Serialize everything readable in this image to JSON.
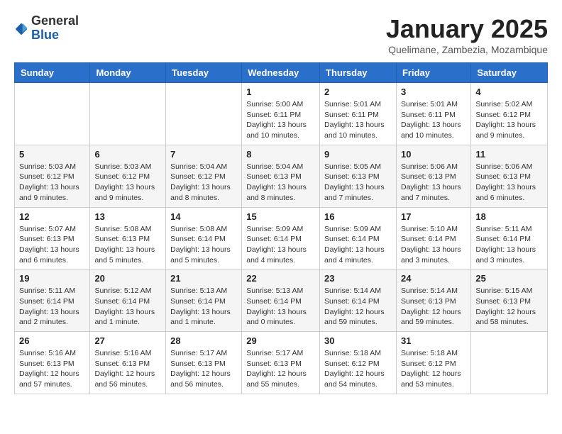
{
  "header": {
    "logo_general": "General",
    "logo_blue": "Blue",
    "month_title": "January 2025",
    "location": "Quelimane, Zambezia, Mozambique"
  },
  "weekdays": [
    "Sunday",
    "Monday",
    "Tuesday",
    "Wednesday",
    "Thursday",
    "Friday",
    "Saturday"
  ],
  "weeks": [
    [
      {
        "day": "",
        "info": ""
      },
      {
        "day": "",
        "info": ""
      },
      {
        "day": "",
        "info": ""
      },
      {
        "day": "1",
        "info": "Sunrise: 5:00 AM\nSunset: 6:11 PM\nDaylight: 13 hours and 10 minutes."
      },
      {
        "day": "2",
        "info": "Sunrise: 5:01 AM\nSunset: 6:11 PM\nDaylight: 13 hours and 10 minutes."
      },
      {
        "day": "3",
        "info": "Sunrise: 5:01 AM\nSunset: 6:11 PM\nDaylight: 13 hours and 10 minutes."
      },
      {
        "day": "4",
        "info": "Sunrise: 5:02 AM\nSunset: 6:12 PM\nDaylight: 13 hours and 9 minutes."
      }
    ],
    [
      {
        "day": "5",
        "info": "Sunrise: 5:03 AM\nSunset: 6:12 PM\nDaylight: 13 hours and 9 minutes."
      },
      {
        "day": "6",
        "info": "Sunrise: 5:03 AM\nSunset: 6:12 PM\nDaylight: 13 hours and 9 minutes."
      },
      {
        "day": "7",
        "info": "Sunrise: 5:04 AM\nSunset: 6:12 PM\nDaylight: 13 hours and 8 minutes."
      },
      {
        "day": "8",
        "info": "Sunrise: 5:04 AM\nSunset: 6:13 PM\nDaylight: 13 hours and 8 minutes."
      },
      {
        "day": "9",
        "info": "Sunrise: 5:05 AM\nSunset: 6:13 PM\nDaylight: 13 hours and 7 minutes."
      },
      {
        "day": "10",
        "info": "Sunrise: 5:06 AM\nSunset: 6:13 PM\nDaylight: 13 hours and 7 minutes."
      },
      {
        "day": "11",
        "info": "Sunrise: 5:06 AM\nSunset: 6:13 PM\nDaylight: 13 hours and 6 minutes."
      }
    ],
    [
      {
        "day": "12",
        "info": "Sunrise: 5:07 AM\nSunset: 6:13 PM\nDaylight: 13 hours and 6 minutes."
      },
      {
        "day": "13",
        "info": "Sunrise: 5:08 AM\nSunset: 6:13 PM\nDaylight: 13 hours and 5 minutes."
      },
      {
        "day": "14",
        "info": "Sunrise: 5:08 AM\nSunset: 6:14 PM\nDaylight: 13 hours and 5 minutes."
      },
      {
        "day": "15",
        "info": "Sunrise: 5:09 AM\nSunset: 6:14 PM\nDaylight: 13 hours and 4 minutes."
      },
      {
        "day": "16",
        "info": "Sunrise: 5:09 AM\nSunset: 6:14 PM\nDaylight: 13 hours and 4 minutes."
      },
      {
        "day": "17",
        "info": "Sunrise: 5:10 AM\nSunset: 6:14 PM\nDaylight: 13 hours and 3 minutes."
      },
      {
        "day": "18",
        "info": "Sunrise: 5:11 AM\nSunset: 6:14 PM\nDaylight: 13 hours and 3 minutes."
      }
    ],
    [
      {
        "day": "19",
        "info": "Sunrise: 5:11 AM\nSunset: 6:14 PM\nDaylight: 13 hours and 2 minutes."
      },
      {
        "day": "20",
        "info": "Sunrise: 5:12 AM\nSunset: 6:14 PM\nDaylight: 13 hours and 1 minute."
      },
      {
        "day": "21",
        "info": "Sunrise: 5:13 AM\nSunset: 6:14 PM\nDaylight: 13 hours and 1 minute."
      },
      {
        "day": "22",
        "info": "Sunrise: 5:13 AM\nSunset: 6:14 PM\nDaylight: 13 hours and 0 minutes."
      },
      {
        "day": "23",
        "info": "Sunrise: 5:14 AM\nSunset: 6:14 PM\nDaylight: 12 hours and 59 minutes."
      },
      {
        "day": "24",
        "info": "Sunrise: 5:14 AM\nSunset: 6:13 PM\nDaylight: 12 hours and 59 minutes."
      },
      {
        "day": "25",
        "info": "Sunrise: 5:15 AM\nSunset: 6:13 PM\nDaylight: 12 hours and 58 minutes."
      }
    ],
    [
      {
        "day": "26",
        "info": "Sunrise: 5:16 AM\nSunset: 6:13 PM\nDaylight: 12 hours and 57 minutes."
      },
      {
        "day": "27",
        "info": "Sunrise: 5:16 AM\nSunset: 6:13 PM\nDaylight: 12 hours and 56 minutes."
      },
      {
        "day": "28",
        "info": "Sunrise: 5:17 AM\nSunset: 6:13 PM\nDaylight: 12 hours and 56 minutes."
      },
      {
        "day": "29",
        "info": "Sunrise: 5:17 AM\nSunset: 6:13 PM\nDaylight: 12 hours and 55 minutes."
      },
      {
        "day": "30",
        "info": "Sunrise: 5:18 AM\nSunset: 6:12 PM\nDaylight: 12 hours and 54 minutes."
      },
      {
        "day": "31",
        "info": "Sunrise: 5:18 AM\nSunset: 6:12 PM\nDaylight: 12 hours and 53 minutes."
      },
      {
        "day": "",
        "info": ""
      }
    ]
  ]
}
